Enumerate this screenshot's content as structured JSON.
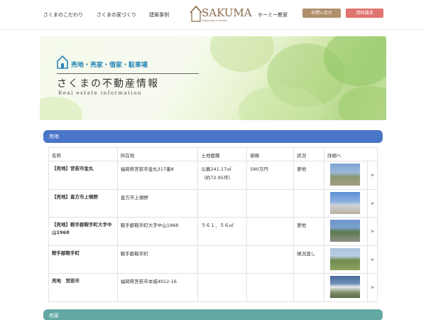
{
  "header": {
    "nav": [
      "さくまのこだわり",
      "さくまの家づくり",
      "建築事例",
      "ホーミー教室"
    ],
    "logo_text": "SAKUMA",
    "logo_sub": "Happiness of Homes",
    "contact_label": "お問い合せ",
    "request_label": "資料請求",
    "colors": {
      "contact": "#b08f6a",
      "request": "#e07470"
    }
  },
  "hero": {
    "tag": "売地・売家・借家・駐車場",
    "title": "さくまの不動産情報",
    "subtitle": "Real estate information"
  },
  "sections": {
    "land": "売地",
    "house": "売家"
  },
  "table": {
    "headers": [
      "名称",
      "所在地",
      "土地面積",
      "価格",
      "状況",
      "詳細へ"
    ],
    "rows": [
      {
        "name": "【売地】宮若市金丸",
        "address": "福岡県宮若市金丸317番8",
        "area": "公募241.17㎡",
        "area2": "（約72.95坪）",
        "price": "580万円",
        "status": "更地",
        "arrow": ">"
      },
      {
        "name": "【売地】直方市上頓野",
        "address": "直方市上頓野",
        "area": "",
        "area2": "",
        "price": "",
        "status": "",
        "arrow": ">"
      },
      {
        "name": "【売地】鞍手郡鞍手町大字中山1968",
        "address": "鞍手郡鞍手町大字中山1968",
        "area": "５６１．５６㎡",
        "area2": "",
        "price": "",
        "status": "更地",
        "arrow": ">"
      },
      {
        "name": "鞍手郡鞍手町",
        "address": "鞍手郡鞍手町",
        "area": "",
        "area2": "",
        "price": "",
        "status": "現況渡し",
        "arrow": ">"
      },
      {
        "name": "売地　宮若市",
        "address": "福岡県宮若市本城4912-16",
        "area": "",
        "area2": "",
        "price": "",
        "status": "",
        "arrow": ">"
      }
    ]
  }
}
